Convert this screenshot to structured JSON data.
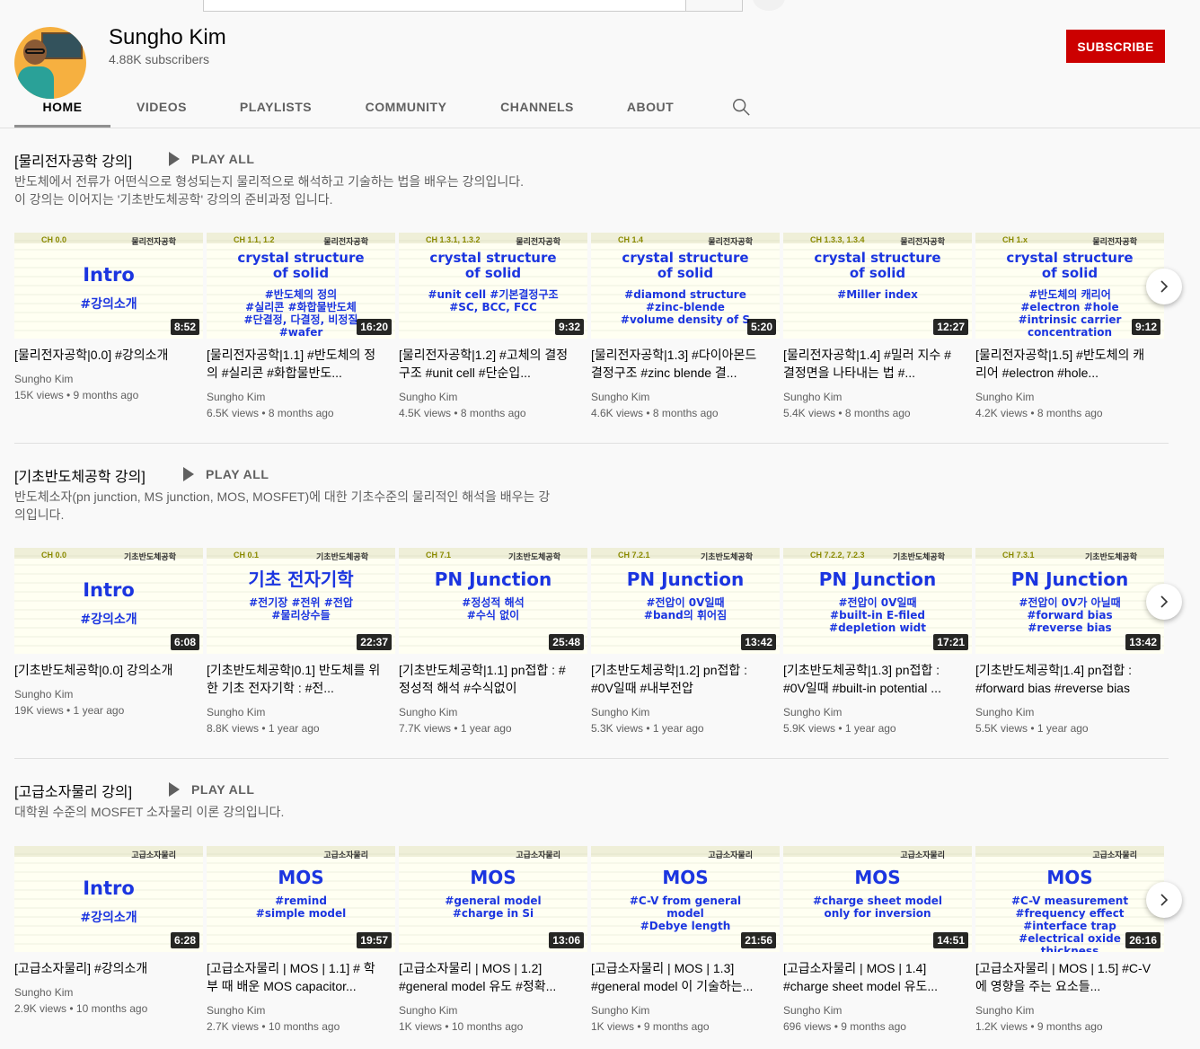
{
  "channel": {
    "name": "Sungho Kim",
    "subscribers": "4.88K subscribers",
    "subscribe_label": "SUBSCRIBE"
  },
  "tabs": [
    "HOME",
    "VIDEOS",
    "PLAYLISTS",
    "COMMUNITY",
    "CHANNELS",
    "ABOUT"
  ],
  "shelves": [
    {
      "title": "[물리전자공학 강의]",
      "play_all": "PLAY ALL",
      "desc": [
        "반도체에서 전류가 어떤식으로 형성되는지 물리적으로 해석하고 기술하는 법을 배우는 강의입니다.",
        "이 강의는 이어지는 '기초반도체공학' 강의의 준비과정 입니다."
      ],
      "videos": [
        {
          "ch": "CH 0.0",
          "course": "물리전자공학",
          "big": [
            "Intro"
          ],
          "tags": [
            "#강의소개"
          ],
          "duration": "8:52",
          "title": "[물리전자공학|0.0] #강의소개",
          "author": "Sungho Kim",
          "meta": "15K views • 9 months ago"
        },
        {
          "ch": "CH 1.1, 1.2",
          "course": "물리전자공학",
          "big": [
            "crystal structure",
            "of solid"
          ],
          "tags": [
            "#반도체의 정의",
            "#실리콘 #화합물반도체",
            "#단결정, 다결정, 비정질",
            "#wafer"
          ],
          "duration": "16:20",
          "title": "[물리전자공학|1.1] #반도체의 정의 #실리콘 #화합물반도...",
          "author": "Sungho Kim",
          "meta": "6.5K views • 8 months ago"
        },
        {
          "ch": "CH 1.3.1, 1.3.2",
          "course": "물리전자공학",
          "big": [
            "crystal structure",
            "of solid"
          ],
          "tags": [
            "#unit cell #기본결정구조",
            "#SC, BCC, FCC"
          ],
          "duration": "9:32",
          "title": "[물리전자공학|1.2] #고체의 결정구조 #unit cell #단순입...",
          "author": "Sungho Kim",
          "meta": "4.5K views • 8 months ago"
        },
        {
          "ch": "CH 1.4",
          "course": "물리전자공학",
          "big": [
            "crystal structure",
            "of solid"
          ],
          "tags": [
            "#diamond structure",
            "#zinc-blende",
            "#volume density of S"
          ],
          "duration": "5:20",
          "title": "[물리전자공학|1.3] #다이아몬드 결정구조 #zinc blende 결...",
          "author": "Sungho Kim",
          "meta": "4.6K views • 8 months ago"
        },
        {
          "ch": "CH 1.3.3, 1.3.4",
          "course": "물리전자공학",
          "big": [
            "crystal structure",
            "of solid"
          ],
          "tags": [
            "#Miller index"
          ],
          "duration": "12:27",
          "title": "[물리전자공학|1.4] #밀러 지수 #결정면을 나타내는 법 #...",
          "author": "Sungho Kim",
          "meta": "5.4K views • 8 months ago"
        },
        {
          "ch": "CH 1.x",
          "course": "물리전자공학",
          "big": [
            "crystal structure",
            "of solid"
          ],
          "tags": [
            "#반도체의 캐리어",
            "#electron #hole",
            "#intrinsic carrier",
            "concentration"
          ],
          "duration": "9:12",
          "title": "[물리전자공학|1.5] #반도체의 캐리어 #electron #hole...",
          "author": "Sungho Kim",
          "meta": "4.2K views • 8 months ago"
        }
      ]
    },
    {
      "title": "[기초반도체공학 강의]",
      "play_all": "PLAY ALL",
      "desc": [
        "반도체소자(pn junction, MS junction, MOS, MOSFET)에 대한 기초수준의 물리적인 해석을 배우는 강",
        "의입니다."
      ],
      "videos": [
        {
          "ch": "CH 0.0",
          "course": "기초반도체공학",
          "big": [
            "Intro"
          ],
          "tags": [
            "#강의소개"
          ],
          "duration": "6:08",
          "title": "[기초반도체공학|0.0] 강의소개",
          "author": "Sungho Kim",
          "meta": "19K views • 1 year ago"
        },
        {
          "ch": "CH 0.1",
          "course": "기초반도체공학",
          "big": [
            "기초 전자기학"
          ],
          "tags": [
            "#전기장 #전위 #전압",
            "#물리상수들"
          ],
          "duration": "22:37",
          "title": "[기초반도체공학|0.1] 반도체를 위한 기초 전자기학 : #전...",
          "author": "Sungho Kim",
          "meta": "8.8K views • 1 year ago"
        },
        {
          "ch": "CH 7.1",
          "course": "기초반도체공학",
          "big": [
            "PN Junction"
          ],
          "tags": [
            "#정성적 해석",
            "#수식 없이"
          ],
          "duration": "25:48",
          "title": "[기초반도체공학|1.1] pn접합 : #정성적 해석 #수식없이",
          "author": "Sungho Kim",
          "meta": "7.7K views • 1 year ago"
        },
        {
          "ch": "CH 7.2.1",
          "course": "기초반도체공학",
          "big": [
            "PN Junction"
          ],
          "tags": [
            "#전압이 0V일때",
            "#band의 휘어짐"
          ],
          "duration": "13:42",
          "title": "[기초반도체공학|1.2] pn접합 : #0V일때 #내부전압",
          "author": "Sungho Kim",
          "meta": "5.3K views • 1 year ago"
        },
        {
          "ch": "CH 7.2.2, 7.2.3",
          "course": "기초반도체공학",
          "big": [
            "PN Junction"
          ],
          "tags": [
            "#전압이 0V일때",
            "#built-in E-filed",
            "#depletion widt"
          ],
          "duration": "17:21",
          "title": "[기초반도체공학|1.3] pn접합 : #0V일때 #built-in potential ...",
          "author": "Sungho Kim",
          "meta": "5.9K views • 1 year ago"
        },
        {
          "ch": "CH 7.3.1",
          "course": "기초반도체공학",
          "big": [
            "PN Junction"
          ],
          "tags": [
            "#전압이 0V가 아닐때",
            "#forward bias",
            "#reverse bias"
          ],
          "duration": "13:42",
          "title": "[기초반도체공학|1.4] pn접합 : #forward bias #reverse bias",
          "author": "Sungho Kim",
          "meta": "5.5K views • 1 year ago"
        }
      ]
    },
    {
      "title": "[고급소자물리 강의]",
      "play_all": "PLAY ALL",
      "desc": [
        "대학원 수준의 MOSFET 소자물리 이론 강의입니다."
      ],
      "videos": [
        {
          "ch": "",
          "course": "고급소자물리",
          "big": [
            "Intro"
          ],
          "tags": [
            "#강의소개"
          ],
          "duration": "6:28",
          "title": "[고급소자물리] #강의소개",
          "author": "Sungho Kim",
          "meta": "2.9K views • 10 months ago"
        },
        {
          "ch": "",
          "course": "고급소자물리",
          "big": [
            "MOS"
          ],
          "tags": [
            "#remind",
            "#simple model"
          ],
          "duration": "19:57",
          "title": "[고급소자물리 | MOS | 1.1] # 학부 때 배운 MOS capacitor...",
          "author": "Sungho Kim",
          "meta": "2.7K views • 10 months ago"
        },
        {
          "ch": "",
          "course": "고급소자물리",
          "big": [
            "MOS"
          ],
          "tags": [
            "#general model",
            "#charge in Si"
          ],
          "duration": "13:06",
          "title": "[고급소자물리 | MOS | 1.2] #general model 유도 #정확...",
          "author": "Sungho Kim",
          "meta": "1K views • 10 months ago"
        },
        {
          "ch": "",
          "course": "고급소자물리",
          "big": [
            "MOS"
          ],
          "tags": [
            "#C-V from general",
            "model",
            "#Debye length"
          ],
          "duration": "21:56",
          "title": "[고급소자물리 | MOS | 1.3] #general model 이 기술하는...",
          "author": "Sungho Kim",
          "meta": "1K views • 9 months ago"
        },
        {
          "ch": "",
          "course": "고급소자물리",
          "big": [
            "MOS"
          ],
          "tags": [
            "#charge sheet model",
            "only for inversion"
          ],
          "duration": "14:51",
          "title": "[고급소자물리 | MOS | 1.4] #charge sheet model 유도...",
          "author": "Sungho Kim",
          "meta": "696 views • 9 months ago"
        },
        {
          "ch": "",
          "course": "고급소자물리",
          "big": [
            "MOS"
          ],
          "tags": [
            "#C-V measurement",
            "#frequency effect",
            "#interface trap",
            "#electrical oxide",
            "thickness"
          ],
          "duration": "26:16",
          "title": "[고급소자물리 | MOS | 1.5] #C-V 에 영향을 주는 요소들...",
          "author": "Sungho Kim",
          "meta": "1.2K views • 9 months ago"
        }
      ]
    }
  ]
}
